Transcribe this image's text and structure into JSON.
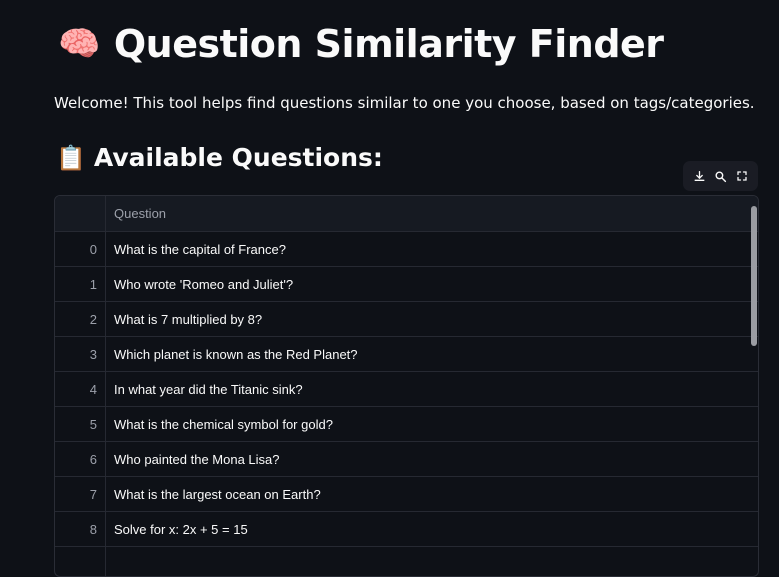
{
  "header": {
    "title": "Question Similarity Finder",
    "title_emoji": "🧠",
    "intro": "Welcome! This tool helps find questions similar to one you choose, based on tags/categories."
  },
  "section": {
    "title": "Available Questions:",
    "emoji": "📋"
  },
  "toolbar": {
    "icons": [
      "download-icon",
      "search-icon",
      "fullscreen-icon"
    ]
  },
  "table": {
    "column_header": "Question",
    "rows": [
      {
        "index": "0",
        "question": "What is the capital of France?"
      },
      {
        "index": "1",
        "question": "Who wrote 'Romeo and Juliet'?"
      },
      {
        "index": "2",
        "question": "What is 7 multiplied by 8?"
      },
      {
        "index": "3",
        "question": "Which planet is known as the Red Planet?"
      },
      {
        "index": "4",
        "question": "In what year did the Titanic sink?"
      },
      {
        "index": "5",
        "question": "What is the chemical symbol for gold?"
      },
      {
        "index": "6",
        "question": "Who painted the Mona Lisa?"
      },
      {
        "index": "7",
        "question": "What is the largest ocean on Earth?"
      },
      {
        "index": "8",
        "question": "Solve for x: 2x + 5 = 15"
      }
    ]
  },
  "colors": {
    "background": "#0e1117",
    "text": "#fafafa",
    "muted": "#9ca0aa",
    "border": "#262932"
  }
}
